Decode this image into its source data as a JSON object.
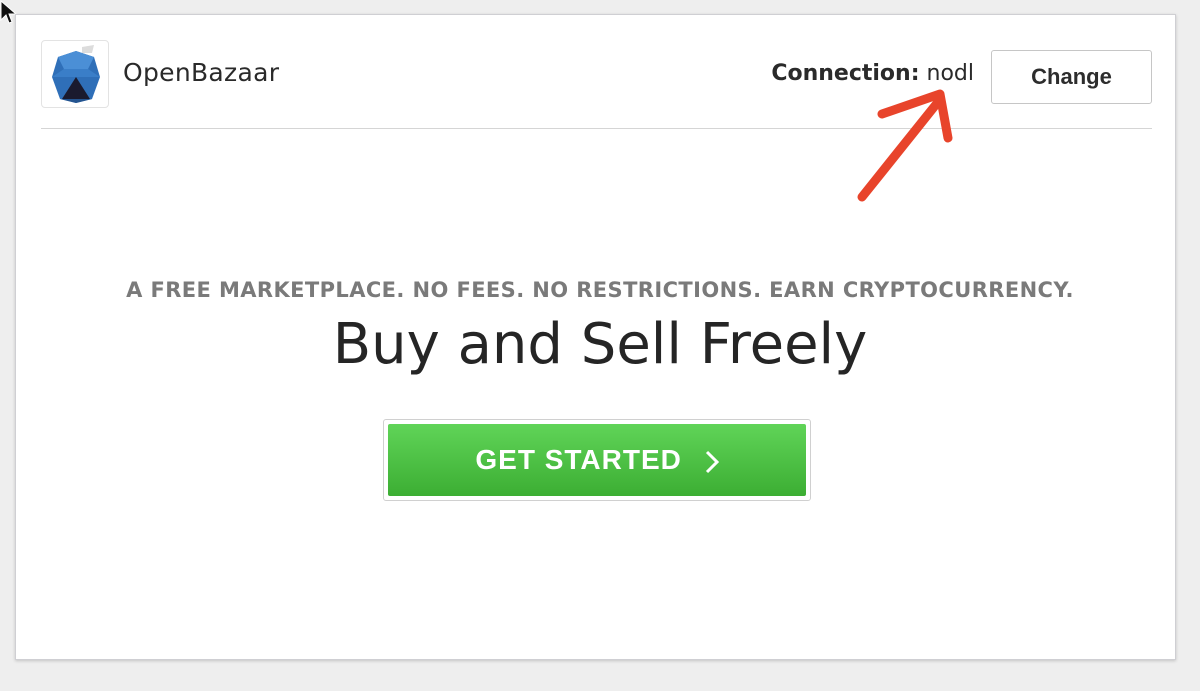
{
  "header": {
    "brand_name": "OpenBazaar",
    "connection_label": "Connection:",
    "connection_value": "nodl",
    "change_label": "Change"
  },
  "hero": {
    "tagline": "A FREE MARKETPLACE. NO FEES. NO RESTRICTIONS. EARN CRYPTOCURRENCY.",
    "headline": "Buy and Sell Freely",
    "cta_label": "GET STARTED"
  },
  "icons": [
    "mouse-cursor-icon",
    "openbazaar-logo-icon",
    "chevron-right-icon",
    "annotation-arrow-icon"
  ],
  "colors": {
    "cta_green": "#4cc044",
    "annotation_red": "#e8442b",
    "logo_blue": "#2f6fb8"
  }
}
